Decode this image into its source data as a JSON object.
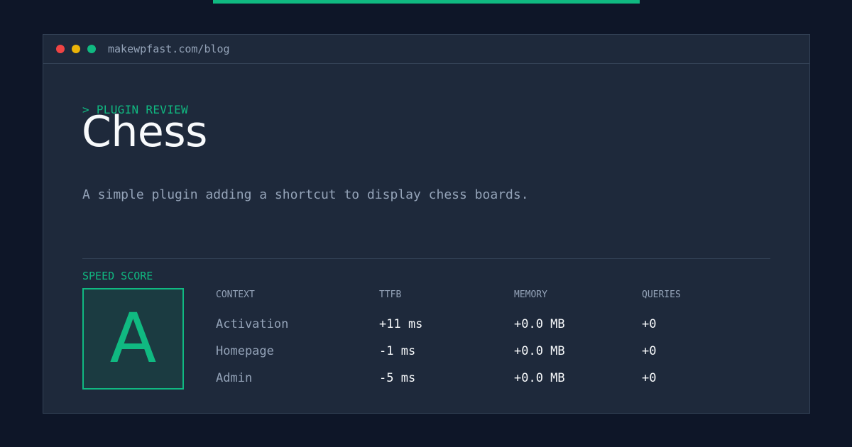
{
  "browser": {
    "url": "makewpfast.com/blog"
  },
  "header": {
    "eyebrow": "> PLUGIN REVIEW",
    "title": "Chess",
    "description": "A simple plugin adding a shortcut to display chess boards."
  },
  "score": {
    "label": "SPEED SCORE",
    "grade": "A"
  },
  "table": {
    "columns": [
      "CONTEXT",
      "TTFB",
      "MEMORY",
      "QUERIES"
    ],
    "rows": [
      [
        "Activation",
        "+11 ms",
        "+0.0 MB",
        "+0"
      ],
      [
        "Homepage",
        "-1 ms",
        "+0.0 MB",
        "+0"
      ],
      [
        "Admin",
        "-5 ms",
        "+0.0 MB",
        "+0"
      ]
    ]
  },
  "colors": {
    "accent": "#10b981",
    "background": "#0e1628",
    "panel": "#1e293b",
    "muted_text": "#94a3b8",
    "text": "#f8fafc"
  }
}
